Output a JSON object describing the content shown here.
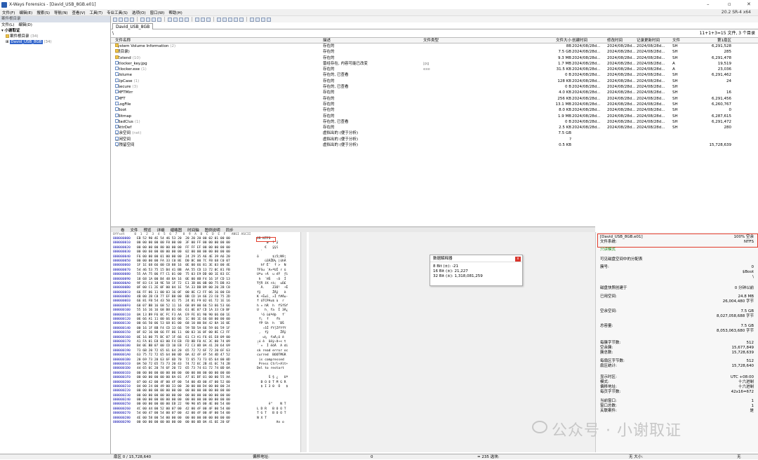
{
  "window": {
    "title": "X-Ways Forensics - [David_USB_8GB.e01]",
    "version": "20.2 SR-4 x64"
  },
  "menu": [
    "文件(F)",
    "编辑(E)",
    "搜索(S)",
    "导航(N)",
    "查看(V)",
    "工具(T)",
    "专业工具(S)",
    "选项(O)",
    "窗口(W)",
    "帮助(H)"
  ],
  "left_pane": {
    "header": "案件根目录",
    "menu": [
      "文件(L)",
      "编辑(D)"
    ],
    "tree": [
      {
        "label": "小谢取证",
        "count": ""
      },
      {
        "label": "案件根目录",
        "count": "(34)"
      },
      {
        "label": "David_USB_8GB",
        "count": "(34)"
      }
    ]
  },
  "tab": {
    "label": "David_USB_8GB"
  },
  "path": {
    "value": "\\",
    "summary": "11+1+3=15 文件, 3 个目录"
  },
  "columns": {
    "name": "文件名称",
    "desc": "描述",
    "type": "文件类型",
    "size": "文件大小",
    "created": "创建时间",
    "modified": "修改时间",
    "record": "记录更新时间",
    "attr": "文件",
    "sector": "第1扇区"
  },
  "files": [
    {
      "name": "System Volume Information",
      "cnt": "(2)",
      "desc": "存在的",
      "type": "",
      "size": "8B",
      "c1": "2024/08/28d...",
      "c2": "2024/08/28d...",
      "c3": "2024/08/28d...",
      "attr": "SH",
      "sec": "6,291,528",
      "icon": "folder"
    },
    {
      "name": "(根目录)",
      "cnt": "",
      "desc": "存在的",
      "type": "",
      "size": "7.5 GB",
      "c1": "2024/08/28d...",
      "c2": "2024/08/28d...",
      "c3": "2024/08/28d...",
      "attr": "SH",
      "sec": "285",
      "icon": "folder"
    },
    {
      "name": "$Extend",
      "cnt": "(10)",
      "desc": "存在的",
      "type": "",
      "size": "9.3 MB",
      "c1": "2024/08/28d...",
      "c2": "2024/08/28d...",
      "c3": "2024/08/28d...",
      "attr": "SH",
      "sec": "6,291,478",
      "icon": "folder"
    },
    {
      "name": "bitlocker_key.jpg",
      "cnt": "",
      "desc": "曾经存在, 内容可能已改变",
      "type": "jpg",
      "size": "1.7 MB",
      "c1": "2024/08/28d...",
      "c2": "2024/08/28d...",
      "c3": "2024/08/28d...",
      "attr": "A",
      "sec": "19,519",
      "icon": "doc"
    },
    {
      "name": "Bitlocker.exe",
      "cnt": "(1)",
      "desc": "存在的",
      "type": "exe",
      "size": "31.5 KB",
      "c1": "2024/08/28d...",
      "c2": "2024/08/28d...",
      "c3": "2024/08/28d...",
      "attr": "A",
      "sec": "23,036",
      "icon": "doc"
    },
    {
      "name": "$Volume",
      "cnt": "",
      "desc": "存在的, 已查看",
      "type": "",
      "size": "0 B",
      "c1": "2024/08/28d...",
      "c2": "2024/08/28d...",
      "c3": "2024/08/28d...",
      "attr": "SH",
      "sec": "6,291,462",
      "icon": "doc"
    },
    {
      "name": "$UpCase",
      "cnt": "(1)",
      "desc": "存在的",
      "type": "",
      "size": "128 KB",
      "c1": "2024/08/28d...",
      "c2": "2024/08/28d...",
      "c3": "2024/08/28d...",
      "attr": "SH",
      "sec": "24",
      "icon": "doc"
    },
    {
      "name": "$Secure",
      "cnt": "(3)",
      "desc": "存在的, 已查看",
      "type": "",
      "size": "0 B",
      "c1": "2024/08/28d...",
      "c2": "2024/08/28d...",
      "c3": "2024/08/28d...",
      "attr": "SH",
      "sec": "",
      "icon": "doc"
    },
    {
      "name": "$MFTMirr",
      "cnt": "",
      "desc": "存在的",
      "type": "",
      "size": "4.0 KB",
      "c1": "2024/08/28d...",
      "c2": "2024/08/28d...",
      "c3": "2024/08/28d...",
      "attr": "SH",
      "sec": "16",
      "icon": "doc"
    },
    {
      "name": "$MFT",
      "cnt": "",
      "desc": "存在的",
      "type": "",
      "size": "256 KB",
      "c1": "2024/08/28d...",
      "c2": "2024/08/28d...",
      "c3": "2024/08/28d...",
      "attr": "SH",
      "sec": "6,291,456",
      "icon": "doc"
    },
    {
      "name": "$LogFile",
      "cnt": "",
      "desc": "存在的",
      "type": "",
      "size": "13.1 MB",
      "c1": "2024/08/28d...",
      "c2": "2024/08/28d...",
      "c3": "2024/08/28d...",
      "attr": "SH",
      "sec": "6,260,767",
      "icon": "doc"
    },
    {
      "name": "$Boot",
      "cnt": "",
      "desc": "存在的",
      "type": "",
      "size": "8.0 KB",
      "c1": "2024/08/28d...",
      "c2": "2024/08/28d...",
      "c3": "2024/08/28d...",
      "attr": "SH",
      "sec": "0",
      "icon": "doc"
    },
    {
      "name": "$Bitmap",
      "cnt": "",
      "desc": "存在的",
      "type": "",
      "size": "1.9 MB",
      "c1": "2024/08/28d...",
      "c2": "2024/08/28d...",
      "c3": "2024/08/28d...",
      "attr": "SH",
      "sec": "6,287,615",
      "icon": "doc"
    },
    {
      "name": "$BadClus",
      "cnt": "(1)",
      "desc": "存在的, 已查看",
      "type": "",
      "size": "0 B",
      "c1": "2024/08/28d...",
      "c2": "2024/08/28d...",
      "c3": "2024/08/28d...",
      "attr": "SH",
      "sec": "6,291,472",
      "icon": "doc"
    },
    {
      "name": "$AttrDef",
      "cnt": "",
      "desc": "存在的",
      "type": "",
      "size": "2.5 KB",
      "c1": "2024/08/28d...",
      "c2": "2024/08/28d...",
      "c3": "2024/08/28d...",
      "attr": "SH",
      "sec": "280",
      "icon": "doc"
    },
    {
      "name": "空余空间",
      "cnt": "(net)",
      "desc": "虚拟出的 (便于分析)",
      "type": "",
      "size": "7.5 GB",
      "c1": "",
      "c2": "",
      "c3": "",
      "attr": "",
      "sec": "",
      "icon": "doc"
    },
    {
      "name": "空闲空间",
      "cnt": "",
      "desc": "虚拟出的 (便于分析)",
      "type": "",
      "size": "?",
      "c1": "",
      "c2": "",
      "c3": "",
      "attr": "",
      "sec": "",
      "icon": "doc"
    },
    {
      "name": "卷残留空间",
      "cnt": "",
      "desc": "虚拟出的 (便于分析)",
      "type": "",
      "size": "0.5 KB",
      "c1": "",
      "c2": "",
      "c3": "",
      "attr": "",
      "sec": "15,728,639",
      "icon": "doc"
    }
  ],
  "midtool": [
    "卷",
    "文件",
    "预览",
    "详细",
    "缩略图",
    "时间轴",
    "图例说明",
    "同步"
  ],
  "hex": {
    "header": "Offset     0  1  2  3  4  5  6  7   8  9  A  B  C  D  E  F   ANSI ASCII",
    "rows": [
      [
        "000000000",
        "EB 52 90 4E 54 46 53 20  20 20 20 00 02 01 00 00",
        "ëR NTFS     "
      ],
      [
        "000000010",
        "00 00 00 00 00 F8 00 00  3F 00 FF 00 00 00 00 00",
        "     ø  ? ÿ  "
      ],
      [
        "000000020",
        "00 00 00 00 80 00 00 00  FF FF EF 00 00 00 00 00",
        "    €   ÿÿï  "
      ],
      [
        "000000030",
        "00 00 60 00 00 00 00 00  02 00 00 00 00 00 00 00",
        "  `          "
      ],
      [
        "000000040",
        "F6 00 00 00 01 00 00 00  24 29 35 A6 4E 39 A6 20",
        "ö       $)5¦N9¦"
      ],
      [
        "000000050",
        "00 00 00 00 FA 33 C0 8E  D0 BC 00 7C FB 68 C0 07",
        "    ú3ÀŽÐ¼ |ûhÀ"
      ],
      [
        "000000060",
        "1F 1E 68 66 00 CB 88 16  0E 00 66 81 3E 03 00 4E",
        "  hf Ëˆ  f >  N"
      ],
      [
        "000000070",
        "54 46 53 75 15 B4 41 BB  AA 55 CD 13 72 0C 81 FB",
        "TFSu ´A»ªUÍ r û"
      ],
      [
        "000000080",
        "55 AA 75 06 F7 C1 01 00  75 03 E9 DD 00 1E 83 EC",
        "Uªu ÷Á  u éÝ  ƒì"
      ],
      [
        "000000090",
        "18 68 1A 00 B4 48 8A 16  0E 00 8B F4 16 1F CD 13",
        " h  ´HŠ   ‹ô  Í"
      ],
      [
        "0000000A0",
        "9F 83 C4 18 9E 58 1F 72  E1 3B 06 0B 00 75 DB A3",
        "ŸƒÄ žX rá;  uÛ£"
      ],
      [
        "0000000B0",
        "0F 00 C1 2E 0F 00 04 1E  5A 33 DB B9 00 20 2B C8",
        "  Á.    Z3Û¹  +È"
      ],
      [
        "0000000C0",
        "66 FF 06 11 00 03 16 0F  00 8E C2 FF 06 16 00 E8",
        "fÿ      ŽÂÿ   è"
      ],
      [
        "0000000D0",
        "4B 00 2B C8 77 EF B8 00  BB CD 1A 66 23 C0 75 2D",
        "K +Èwï¸ »Í f#Àu-"
      ],
      [
        "0000000E0",
        "66 81 FB 54 43 50 41 75  24 81 F9 02 01 72 1E 16",
        "f ûTCPAu$ ù  r"
      ],
      [
        "0000000F0",
        "68 07 BB 16 68 52 11 16  68 09 00 66 53 66 53 66",
        "h » hR  h  fSfSf"
      ],
      [
        "000000100",
        "55 16 16 16 68 B8 01 66  61 0E 07 CD 1A 33 C0 BF",
        "U   h¸ fa  Í 3À¿"
      ],
      [
        "000000110",
        "0A 13 B9 F6 0C FC F3 AA  E9 FE 01 90 90 66 60 1E",
        "  ¹ö üóªéþ   f`"
      ],
      [
        "000000120",
        "06 66 A1 11 00 66 03 06  1C 00 1E 66 68 00 00 00",
        " f¡  f    fh"
      ],
      [
        "000000130",
        "00 66 50 06 53 68 01 00  68 10 00 B4 42 8A 16 0E",
        " fP Sh  h  ´BŠ"
      ],
      [
        "000000140",
        "00 16 1F 8B F4 CD 13 66  59 5B 5A 66 59 66 59 1F",
        "   ‹ôÍ fY[ZfYfY"
      ],
      [
        "000000150",
        "0F 82 16 00 66 FF 06 11  00 03 16 0F 00 8E C2 FF",
        " ‚  fÿ      ŽÂÿ"
      ],
      [
        "000000160",
        "0E 16 00 75 BC 07 1F 66  61 C3 A1 F6 01 E8 09 00",
        "   u¼  faÃ¡ö è"
      ],
      [
        "000000170",
        "A1 FA 01 E8 03 00 F4 EB  FD 8B F0 AC 3C 00 74 09",
        "¡ú è  ôëý‹ð¬< t"
      ],
      [
        "000000180",
        "B4 0E BB 07 00 CD 10 EB  F2 C3 0D 0A 41 20 64 69",
        "´ »  Í ëòÃ  A di"
      ],
      [
        "000000190",
        "73 6B 20 72 65 61 64 20  65 72 72 6F 72 20 6F 63",
        "sk read error oc"
      ],
      [
        "0000001A0",
        "63 75 72 72 65 64 00 0D  0A 42 4F 4F 54 4D 47 52",
        "curred  BOOTMGR"
      ],
      [
        "0000001B0",
        "20 69 73 20 63 6F 6D 70  72 65 73 73 65 64 00 0D",
        " is compressed"
      ],
      [
        "0000001C0",
        "0A 50 72 65 73 73 20 43  74 72 6C 2B 41 6C 74 2B",
        " Press Ctrl+Alt+"
      ],
      [
        "0000001D0",
        "44 65 6C 20 74 6F 20 72  65 73 74 61 72 74 0D 0A",
        "Del to restart"
      ],
      [
        "0000001E0",
        "00 00 00 00 00 00 00 00  00 00 00 00 00 00 00 00",
        ""
      ],
      [
        "0000001F0",
        "00 00 00 00 00 00 8A 01  A7 01 BF 01 00 00 55 AA",
        "      Š § ¿   Uª"
      ],
      [
        "000000200",
        "07 00 42 00 4F 00 4F 00  54 00 4D 00 47 00 52 00",
        "  B O O T M G R"
      ],
      [
        "000000210",
        "04 00 24 00 49 00 33 00  30 00 00 D4 00 00 00 24",
        "  $ I 3 0  Ô   $"
      ],
      [
        "000000220",
        "00 00 00 00 00 00 00 00  00 00 00 00 00 00 00 00",
        ""
      ],
      [
        "000000230",
        "00 00 00 00 00 00 00 00  00 00 00 00 00 00 00 00",
        ""
      ],
      [
        "000000240",
        "00 00 00 00 00 00 00 00  00 00 00 00 00 00 00 00",
        ""
      ],
      [
        "000000250",
        "00 00 00 00 00 00 EB 22  90 90 05 00 4E 00 54 00",
        "      ë\"    N T"
      ],
      [
        "000000260",
        "4C 00 44 00 52 00 07 00  42 00 4F 00 4F 00 54 00",
        "L D R   B O O T"
      ],
      [
        "000000270",
        "54 00 47 00 54 00 07 00  42 00 4F 00 4F 00 54 00",
        "T G T   B O O T"
      ],
      [
        "000000280",
        "4E 00 58 00 54 00 00 00  00 00 00 00 00 00 00 00",
        "N X T"
      ],
      [
        "000000290",
        "00 00 00 00 00 00 00 00  00 00 0D 0A 41 6E 20 6F",
        "          An o"
      ]
    ]
  },
  "interpreter": {
    "title": "数据解释器",
    "close": "x",
    "lines": [
      "8 Bit (±): -21",
      "16 Bit (±): 21,227",
      "32 Bit (±): 1,318,081,259"
    ]
  },
  "info": {
    "image": "[David_USB_8GB.e01]",
    "free_pct": "100% 空余",
    "fs_label": "文件系统:",
    "fs_value": "NTFS",
    "mode": "只读模式",
    "alloc_label": "可见磁盘空间中的分配表",
    "rows": [
      {
        "k": "簇号:",
        "v": "0"
      },
      {
        "k": "",
        "v": "$Boot"
      },
      {
        "k": "",
        "v": "\\"
      },
      {
        "k": "磁盘快照创建于",
        "v": "0 分钟以前"
      },
      {
        "k": "已用空间:",
        "v": "24.8 MB"
      },
      {
        "k": "",
        "v": "26,004,480 字节"
      },
      {
        "k": "空余空间:",
        "v": "7.5 GB"
      },
      {
        "k": "",
        "v": "8,027,058,688 字节"
      },
      {
        "k": "总容量:",
        "v": "7.5 GB"
      },
      {
        "k": "",
        "v": "8,053,063,680 字节"
      },
      {
        "k": "每簇字节数:",
        "v": "512"
      },
      {
        "k": "空余簇:",
        "v": "15,677,849"
      },
      {
        "k": "簇总数:",
        "v": "15,728,639"
      },
      {
        "k": "每扇区字节数:",
        "v": "512"
      },
      {
        "k": "扇区统计:",
        "v": "15,728,640"
      },
      {
        "k": "显示时区:",
        "v": "UTC +08:00"
      },
      {
        "k": "模式:",
        "v": "十六进制"
      },
      {
        "k": "偏移地址:",
        "v": "十六进制"
      },
      {
        "k": "每页字节数:",
        "v": "42x16=672"
      },
      {
        "k": "当前窗口:",
        "v": "1"
      },
      {
        "k": "窗口总数:",
        "v": "1"
      },
      {
        "k": "关联案件:",
        "v": "是"
      }
    ]
  },
  "watermark": "公众号 · 小谢取证",
  "status": {
    "sector": "扇区 0 / 15,728,640",
    "offset_label": "偏移地址:",
    "offset_val": "0",
    "sel": "= 235 选块:",
    "size": "无 大小:",
    "none": "无"
  }
}
